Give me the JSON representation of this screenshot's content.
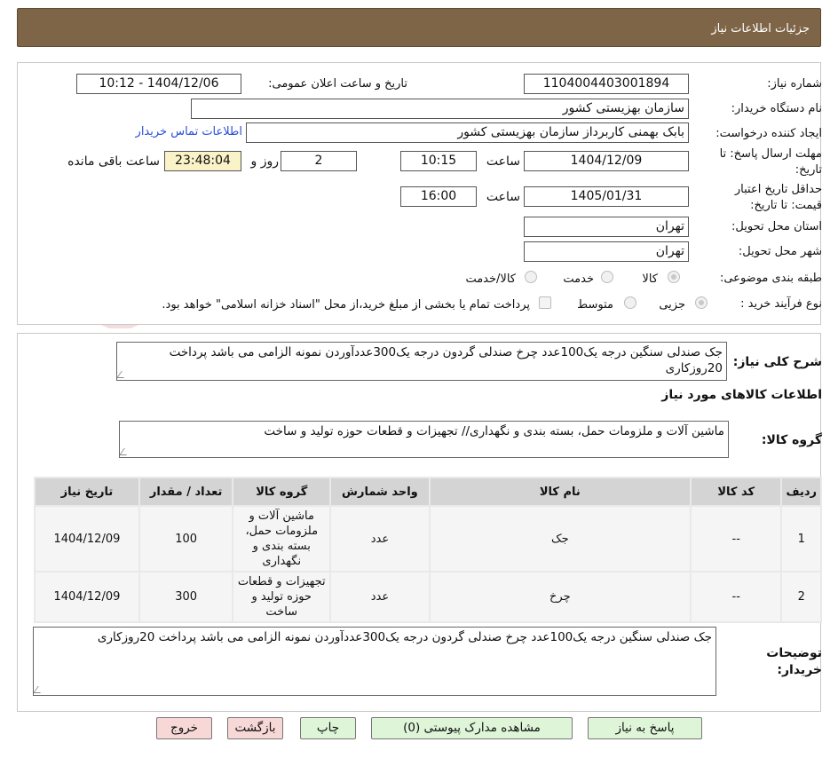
{
  "header": {
    "title": "جزئیات اطلاعات نیاز"
  },
  "form": {
    "need_number_label": "شماره نیاز:",
    "need_number": "1104004403001894",
    "announce_label": "تاریخ و ساعت اعلان عمومی:",
    "announce_value": "1404/12/06 - 10:12",
    "buyer_org_label": "نام دستگاه خریدار:",
    "buyer_org": "سازمان بهزیستی کشور",
    "requester_label": "ایجاد کننده درخواست:",
    "requester": "بابک بهمنی کاربرداز سازمان بهزیستی کشور",
    "contact_link": "اطلاعات تماس خریدار",
    "deadline_label_1": "مهلت ارسال پاسخ: تا",
    "deadline_label_2": "تاریخ:",
    "deadline_date": "1404/12/09",
    "time_label": "ساعت",
    "deadline_time": "10:15",
    "days_value": "2",
    "days_label": "روز و",
    "remaining_time": "23:48:04",
    "remaining_label": "ساعت باقی مانده",
    "validity_label_1": "حداقل تاریخ اعتبار",
    "validity_label_2": "قیمت: تا تاریخ:",
    "validity_date": "1405/01/31",
    "validity_time": "16:00",
    "province_label": "استان محل تحویل:",
    "province": "تهران",
    "city_label": "شهر محل تحویل:",
    "city": "تهران",
    "category_label": "طبقه بندی موضوعی:",
    "category_options": [
      "کالا",
      "خدمت",
      "کالا/خدمت"
    ],
    "purchase_label": "نوع فرآیند خرید :",
    "purchase_options": [
      "جزیی",
      "متوسط"
    ],
    "payment_note": "پرداخت تمام یا بخشی از مبلغ خرید،از محل \"اسناد خزانه اسلامی\" خواهد بود."
  },
  "description": {
    "label": "شرح کلی نیاز:",
    "text": "جک صندلی سنگین درجه یک100عدد چرخ صندلی گردون درجه یک300عددآوردن نمونه الزامی می باشد پرداخت 20روزکاری"
  },
  "goods": {
    "section_title": "اطلاعات کالاهای مورد نیاز",
    "group_label": "گروه کالا:",
    "group_text": "ماشین آلات و ملزومات حمل، بسته بندی و نگهداری// تجهیزات و قطعات حوزه تولید و ساخت"
  },
  "table": {
    "headers": [
      "ردیف",
      "کد کالا",
      "نام کالا",
      "واحد شمارش",
      "گروه کالا",
      "تعداد / مقدار",
      "تاریخ نیاز"
    ],
    "rows": [
      {
        "row": "1",
        "code": "--",
        "name": "جک",
        "unit": "عدد",
        "group": "ماشین آلات و ملزومات حمل، بسته بندی و نگهداری",
        "qty": "100",
        "date": "1404/12/09"
      },
      {
        "row": "2",
        "code": "--",
        "name": "چرخ",
        "unit": "عدد",
        "group": "تجهیزات و قطعات حوزه تولید و ساخت",
        "qty": "300",
        "date": "1404/12/09"
      }
    ]
  },
  "buyer_notes": {
    "label_1": "توضیحات",
    "label_2": "خریدار:",
    "text": "جک صندلی سنگین درجه یک100عدد چرخ صندلی گردون درجه یک300عددآوردن نمونه الزامی می باشد پرداخت 20روزکاری"
  },
  "buttons": {
    "reply": "پاسخ به نیاز",
    "attachments": "مشاهده مدارک پیوستی (0)",
    "print": "چاپ",
    "back": "بازگشت",
    "exit": "خروج"
  },
  "watermark": {
    "text": "AriaTender.net"
  },
  "colors": {
    "header_bg": "#7f6547",
    "link": "#2a4fd6",
    "timer_bg": "#fbf3c8",
    "green_button": "#def5d8",
    "pink_button": "#f8d7d7"
  }
}
